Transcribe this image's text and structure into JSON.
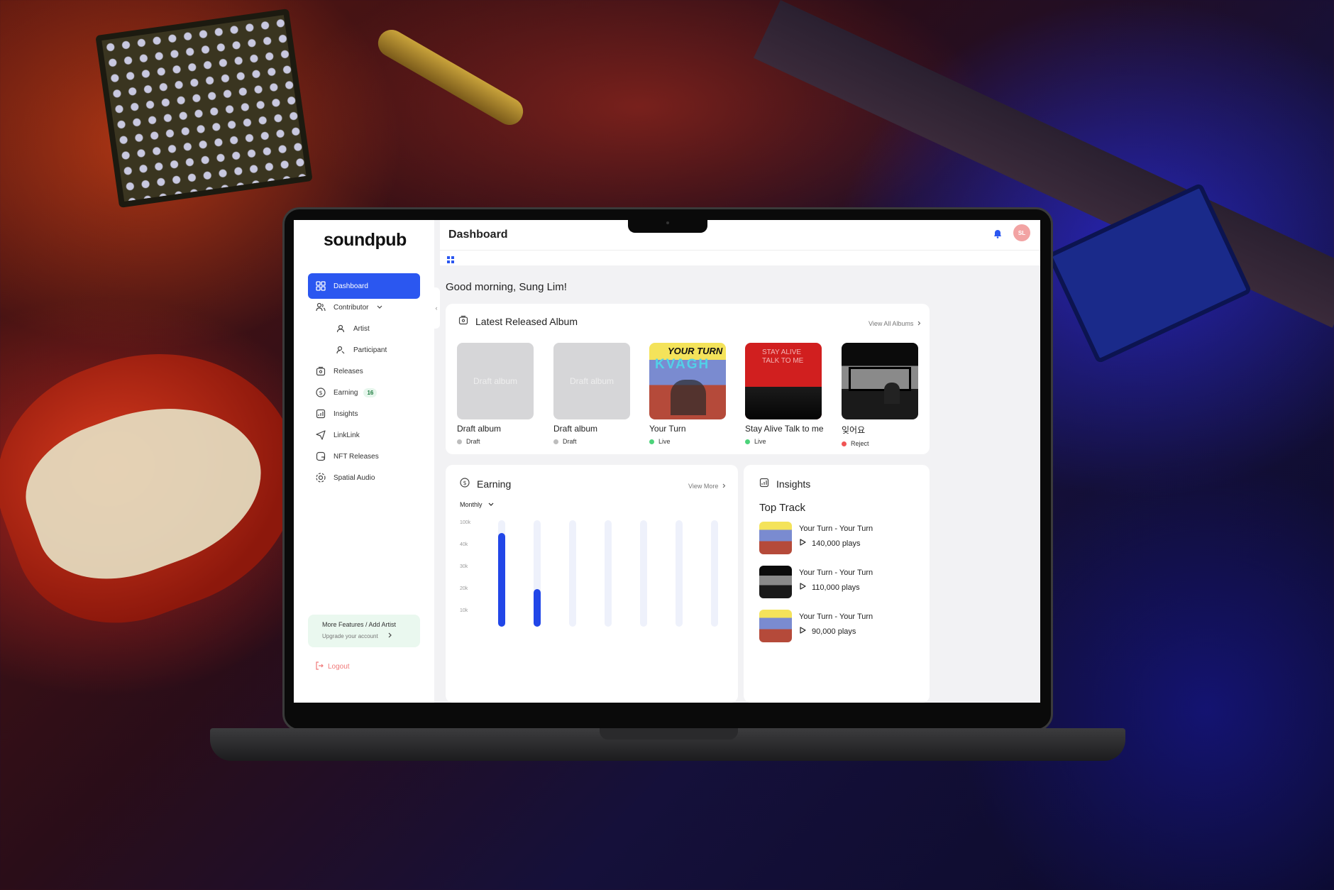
{
  "app": {
    "logo": "soundpub",
    "page_title": "Dashboard",
    "avatar_initials": "SL",
    "accent": "#2b57f0"
  },
  "sidebar": {
    "items": [
      {
        "label": "Dashboard",
        "icon": "dashboard-icon"
      },
      {
        "label": "Contributor",
        "icon": "users-icon"
      },
      {
        "label": "Artist",
        "icon": "user-icon"
      },
      {
        "label": "Participant",
        "icon": "user-icon"
      },
      {
        "label": "Releases",
        "icon": "album-icon"
      },
      {
        "label": "Earning",
        "icon": "dollar-icon",
        "badge": "16"
      },
      {
        "label": "Insights",
        "icon": "chart-icon"
      },
      {
        "label": "LinkLink",
        "icon": "send-icon"
      },
      {
        "label": "NFT Releases",
        "icon": "nft-icon"
      },
      {
        "label": "Spatial Audio",
        "icon": "spatial-icon"
      }
    ],
    "promo_title": "More Features / Add Artist",
    "promo_sub": "Upgrade your account",
    "logout": "Logout"
  },
  "greeting": "Good morning, Sung Lim!",
  "albums_card": {
    "title": "Latest Released Album",
    "view_all": "View All Albums",
    "albums": [
      {
        "cover_text": "Draft album",
        "title": "Draft album",
        "status": "Draft",
        "status_color": "#bdbdbd"
      },
      {
        "cover_text": "Draft album",
        "title": "Draft album",
        "status": "Draft",
        "status_color": "#bdbdbd"
      },
      {
        "title": "Your Turn",
        "status": "Live",
        "status_color": "#4cd37a",
        "cover_top": "YOUR TURN",
        "cover_mid": "KVAGH"
      },
      {
        "title": "Stay Alive Talk to me",
        "status": "Live",
        "status_color": "#4cd37a",
        "cover_top": "STAY ALIVE",
        "cover_mid": "TALK TO ME"
      },
      {
        "title": "잊어요",
        "status": "Reject",
        "status_color": "#f05454"
      }
    ]
  },
  "earning_card": {
    "title": "Earning",
    "view_more": "View More",
    "period": "Monthly",
    "y_ticks": [
      "100k",
      "40k",
      "30k",
      "20k",
      "10k"
    ]
  },
  "chart_data": {
    "type": "bar",
    "title": "Earning",
    "yticks": [
      "100k",
      "40k",
      "30k",
      "20k",
      "10k"
    ],
    "categories": [
      "",
      "",
      "",
      "",
      "",
      "",
      ""
    ],
    "values_fraction": [
      0.88,
      0.35,
      0,
      0,
      0,
      0,
      0
    ]
  },
  "insights_card": {
    "title": "Insights",
    "subtitle": "Top Track",
    "tracks": [
      {
        "name": "Your Turn - Your Turn",
        "plays": "140,000 plays"
      },
      {
        "name": "Your Turn - Your Turn",
        "plays": "110,000 plays"
      },
      {
        "name": "Your Turn - Your Turn",
        "plays": "90,000 plays"
      }
    ]
  }
}
